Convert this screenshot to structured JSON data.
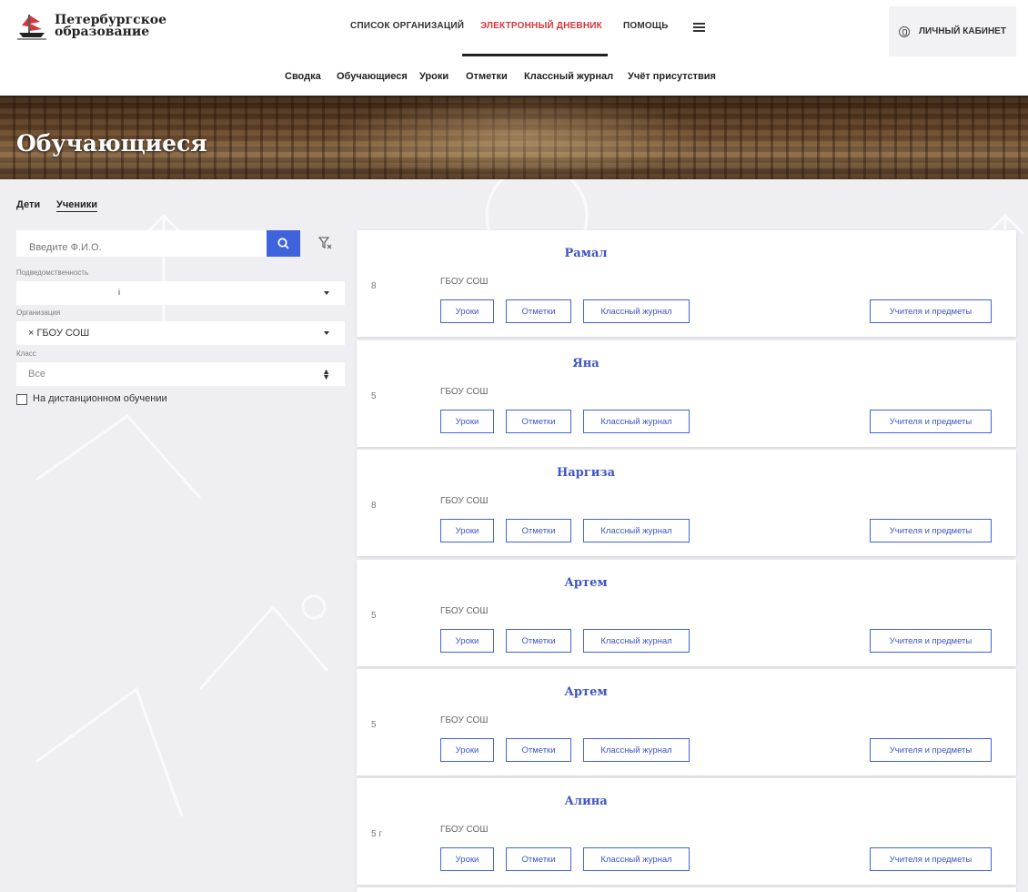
{
  "app": {
    "logo_line1": "Петербургское",
    "logo_line2": "образование"
  },
  "topnav": {
    "items": [
      "Список организаций",
      "Электронный дневник",
      "Помощь"
    ],
    "active": "Электронный дневник",
    "cabinet_label": "Личный кабинет"
  },
  "subnav": {
    "items": [
      "Сводка",
      "Обучающиеся",
      "Уроки",
      "Отметки",
      "Классный журнал",
      "Учёт присутствия"
    ]
  },
  "banner": {
    "title": "Обучающиеся"
  },
  "sidebar": {
    "tabs": [
      "Дети",
      "Ученики"
    ],
    "active_tab": "Ученики",
    "search_placeholder": "Введите Ф.И.О.",
    "subordination_label": "Подведомственность",
    "subordination_value": "i",
    "organization_label": "Организация",
    "organization_value": "× ГБОУ СОШ",
    "class_label": "Класс",
    "class_value": "Все",
    "distance_label": "На дистанционном обучении",
    "distance_checked": false
  },
  "card_buttons": {
    "lessons": "Уроки",
    "marks": "Отметки",
    "journal": "Классный журнал",
    "teachers": "Учителя и предметы"
  },
  "students": [
    {
      "name": "Рамал",
      "class": "8",
      "org": "ГБОУ СОШ"
    },
    {
      "name": "Яна",
      "class": "5",
      "org": "ГБОУ СОШ"
    },
    {
      "name": "Наргиза",
      "class": "8",
      "org": "ГБОУ СОШ"
    },
    {
      "name": "Артем",
      "class": "5",
      "org": "ГБОУ СОШ"
    },
    {
      "name": "Артем",
      "class": "5",
      "org": "ГБОУ СОШ"
    },
    {
      "name": "Алина",
      "class": "5 г",
      "org": "ГБОУ СОШ"
    }
  ],
  "colors": {
    "accent": "#3e63dd",
    "active_nav": "#d5363d",
    "name_link": "#3e55c4"
  }
}
